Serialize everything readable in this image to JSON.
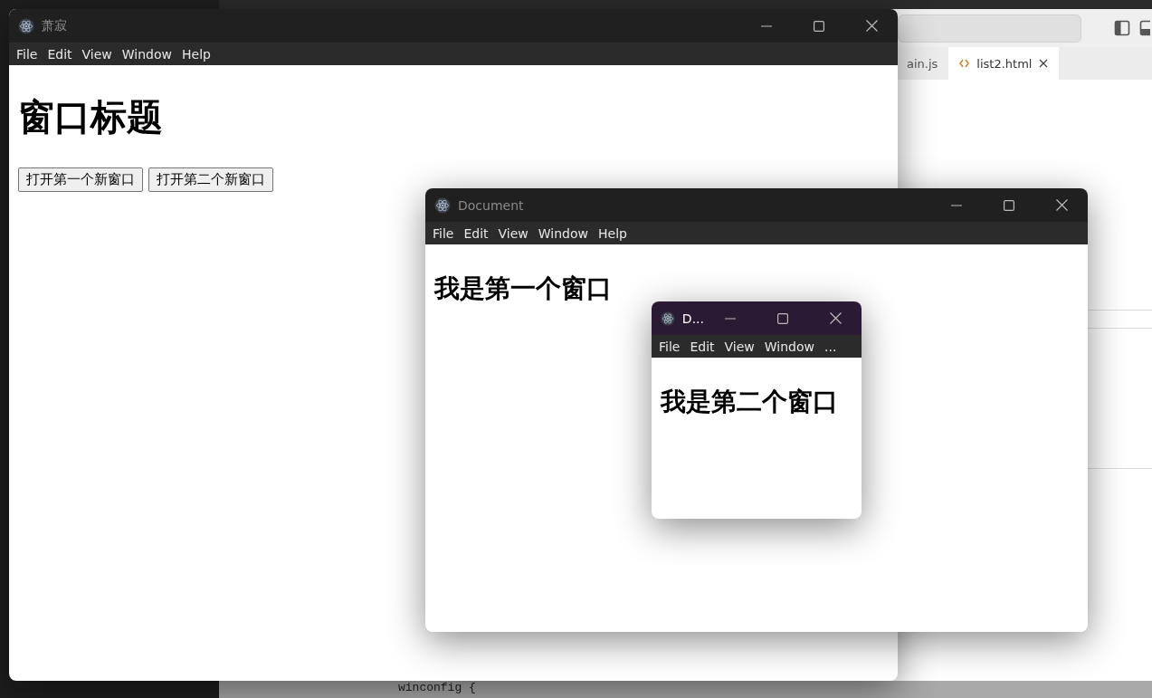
{
  "editor": {
    "tabs": [
      {
        "label": "ain.js",
        "selected": false
      },
      {
        "label": "list2.html",
        "selected": true
      }
    ],
    "code_line": "winconfig {"
  },
  "windows": [
    {
      "kind": "main",
      "title": "萧寂",
      "active": false,
      "menu": [
        "File",
        "Edit",
        "View",
        "Window",
        "Help"
      ],
      "heading": "窗口标题",
      "buttons": [
        "打开第一个新窗口",
        "打开第二个新窗口"
      ]
    },
    {
      "kind": "child",
      "title": "Document",
      "active": false,
      "menu": [
        "File",
        "Edit",
        "View",
        "Window",
        "Help"
      ],
      "heading": "我是第一个窗口"
    },
    {
      "kind": "small",
      "title": "D...",
      "active": true,
      "menu": [
        "File",
        "Edit",
        "View",
        "Window",
        "..."
      ],
      "heading": "我是第二个窗口"
    }
  ]
}
